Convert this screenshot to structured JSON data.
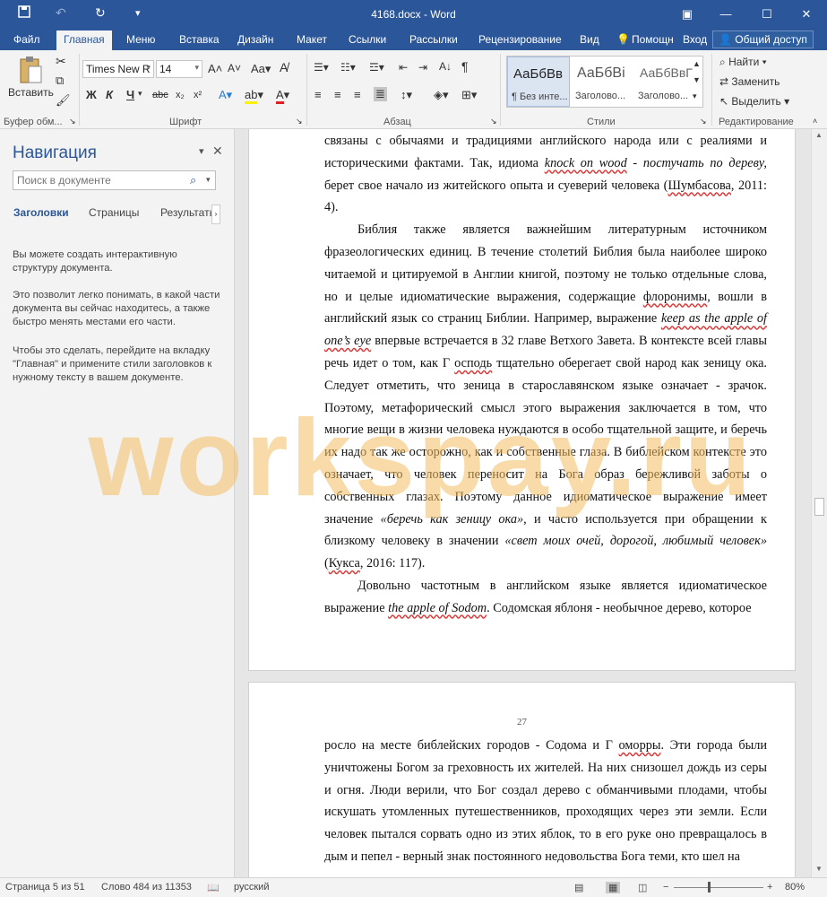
{
  "window": {
    "title": "4168.docx - Word",
    "minimize_icon": "minimize-icon",
    "maximize_icon": "maximize-icon",
    "close_icon": "close-icon"
  },
  "menu": {
    "tabs": [
      "Файл",
      "Главная",
      "Меню",
      "Вставка",
      "Дизайн",
      "Макет",
      "Ссылки",
      "Рассылки",
      "Рецензирование",
      "Вид"
    ],
    "active": "Главная",
    "help": "Помощн",
    "login": "Вход",
    "share": "Общий доступ"
  },
  "ribbon": {
    "paste_label": "Вставить",
    "font_name": "Times New R",
    "font_size": "14",
    "groups": {
      "clipboard": "Буфер обм...",
      "font": "Шрифт",
      "paragraph": "Абзац",
      "styles": "Стили",
      "editing": "Редактирование"
    },
    "bold": "Ж",
    "italic": "К",
    "underline": "Ч",
    "styles": [
      {
        "preview": "АаБбВв",
        "name": "¶ Без инте..."
      },
      {
        "preview": "АаБбВі",
        "name": "Заголово..."
      },
      {
        "preview": "АаБбВвГ",
        "name": "Заголово..."
      }
    ],
    "find": "Найти",
    "replace": "Заменить",
    "select": "Выделить"
  },
  "navigation": {
    "title": "Навигация",
    "search_placeholder": "Поиск в документе",
    "tabs": [
      "Заголовки",
      "Страницы",
      "Результать"
    ],
    "help_p1": "Вы можете создать интерактивную структуру документа.",
    "help_p2": "Это позволит легко понимать, в какой части документа вы сейчас находитесь, а также быстро менять местами его части.",
    "help_p3": "Чтобы это сделать, перейдите на вкладку \"Главная\" и примените стили заголовков к нужному тексту в вашем документе."
  },
  "document": {
    "page1": {
      "p1_a": "связаны с обычаями и традициями английского народа или с реалиями и историческими фактами. Так, идиома ",
      "p1_idiom": "knock on wood",
      "p1_b": " - ",
      "p1_trans": "постучать по дереву,",
      "p1_c": " берет свое начало из житейского опыта и суеверий человека (",
      "p1_cite": "Шумбасова",
      "p1_d": ", 2011: 4).",
      "p2_a": "Библия также является важнейшим литературным источником фразеологических единиц. В течение столетий Библия была наиболее широко читаемой и цитируемой в Англии книгой, поэтому не только отдельные слова, но и целые идиоматические выражения, содержащие ",
      "p2_flor": "флоронимы",
      "p2_b": ", вошли в английский язык со страниц Библии. Например, выражение ",
      "p2_idiom": "keep as the apple of one’s eye",
      "p2_c": " впервые встречается в 32 главе Ветхого Завета. В контексте всей главы речь идет о том, как Г ",
      "p2_lord": "осподь",
      "p2_d": " тщательно оберегает свой народ как зеницу ока. Следует отметить, что зеница в старославянском языке означает - зрачок. Поэтому, метафорический смысл этого выражения заключается в том, что многие вещи в жизни человека нуждаются в особо тщательной защите, и беречь их надо так же осторожно, как и собственные глаза. В библейском контексте это означает, что человек переносит на Бога образ бережливой заботы о собственных глазах. Поэтому данное идиоматическое выражение имеет значение ",
      "p2_mean1": "«беречь как зеницу ока»",
      "p2_e": ", и часто используется при обращении к близкому человеку в значении ",
      "p2_mean2": "«свет моих очей, дорогой, любимый человек»",
      "p2_f": " (",
      "p2_cite": "Кукса",
      "p2_g": ", 2016: 117).",
      "p3_a": "Довольно частотным в английском языке является идиоматическое выражение ",
      "p3_idiom": "the apple of Sodom",
      "p3_b": ". Содомская яблоня - необычное дерево, которое"
    },
    "page2": {
      "number": "27",
      "p1_a": "росло на месте библейских городов - Содома и Г ",
      "p1_gom": "оморры",
      "p1_b": ". Эти города были уничтожены Богом за греховность их жителей. На них снизошел дождь из серы и огня. Люди верили, что Бог создал дерево с обманчивыми плодами, чтобы искушать утомленных путешественников, проходящих через эти земли. Если человек пытался сорвать одно из этих яблок, то в его руке оно превращалось в дым и пепел - верный знак постоянного недовольства Бога теми, кто шел на"
    },
    "watermark": "workspay.ru"
  },
  "status": {
    "page": "Страница 5 из 51",
    "words": "Слово 484 из 11353",
    "language": "русский",
    "zoom": "80%"
  },
  "colors": {
    "accent": "#2b579a",
    "spellcheck": "#d33"
  }
}
